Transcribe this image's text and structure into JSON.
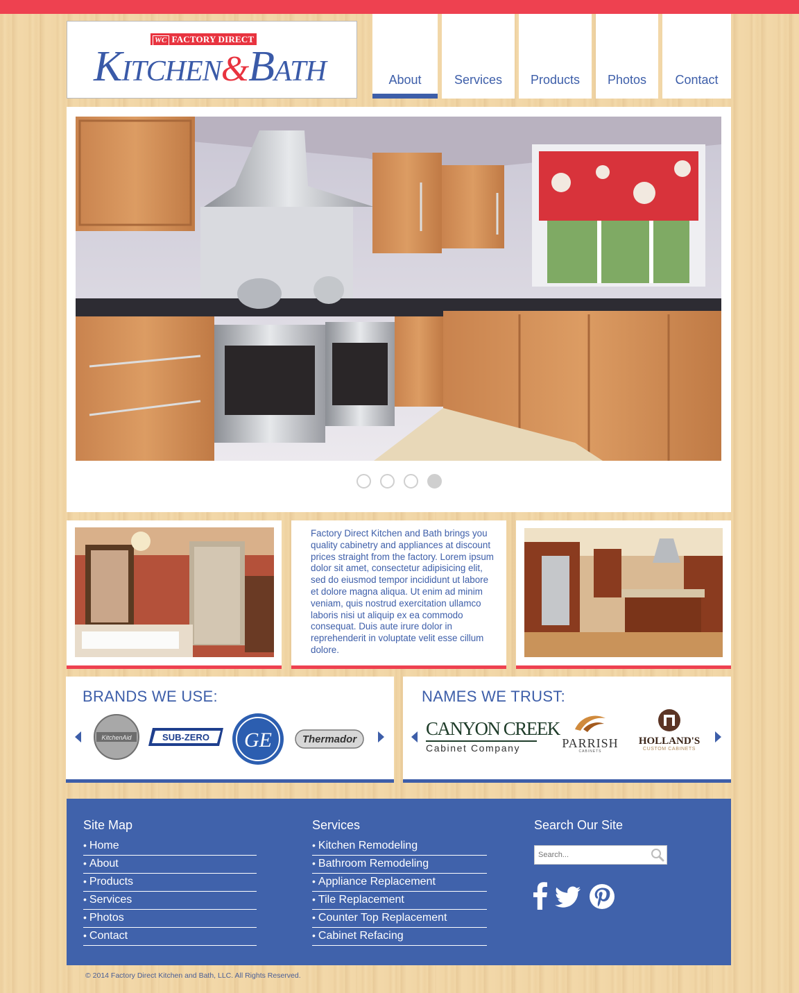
{
  "brand": {
    "tag": "FACTORY DIRECT",
    "tag_initials": "WC",
    "name_k": "K",
    "name_itchen": "ITCHEN",
    "amp": "&",
    "name_b": "B",
    "name_ath": "ATH"
  },
  "nav": [
    "About",
    "Services",
    "Products",
    "Photos",
    "Contact"
  ],
  "intro": "Factory Direct Kitchen and Bath brings you quality cabinetry and appliances at discount prices straight from the factory. Lorem ipsum dolor sit amet, consectetur adipisicing elit, sed do eiusmod tempor incididunt ut labore et dolore magna aliqua. Ut enim ad minim veniam, quis nostrud exercitation ullamco laboris nisi ut aliquip ex ea commodo consequat. Duis aute irure dolor in reprehenderit in voluptate velit esse cillum dolore.",
  "brands": {
    "title": "BRANDS WE USE:",
    "logos": [
      "KitchenAid",
      "SUB-ZERO",
      "GE",
      "Thermador"
    ]
  },
  "names": {
    "title": "NAMES WE TRUST:",
    "canyon_line1": "CANYON CREEK",
    "canyon_line2": "Cabinet Company",
    "parrish": "PARRISH",
    "parrish_sub": "CABINETS",
    "hollands": "HOLLAND'S",
    "hollands_sub": "CUSTOM CABINETS"
  },
  "footer": {
    "sitemap_title": "Site Map",
    "sitemap": [
      "Home",
      "About",
      "Products",
      "Services",
      "Photos",
      "Contact"
    ],
    "services_title": "Services",
    "services": [
      "Kitchen Remodeling",
      "Bathroom Remodeling",
      "Appliance Replacement",
      "Tile Replacement",
      "Counter Top Replacement",
      "Cabinet Refacing"
    ],
    "search_title": "Search Our Site",
    "search_placeholder": "Search..."
  },
  "copyright": "© 2014 Factory Direct Kitchen and Bath, LLC. All Rights Reserved.",
  "colors": {
    "accent_red": "#ee4150",
    "brand_blue": "#3d5ea9",
    "footer_blue": "#4062ab"
  },
  "slider": {
    "count": 4,
    "active": 4
  }
}
